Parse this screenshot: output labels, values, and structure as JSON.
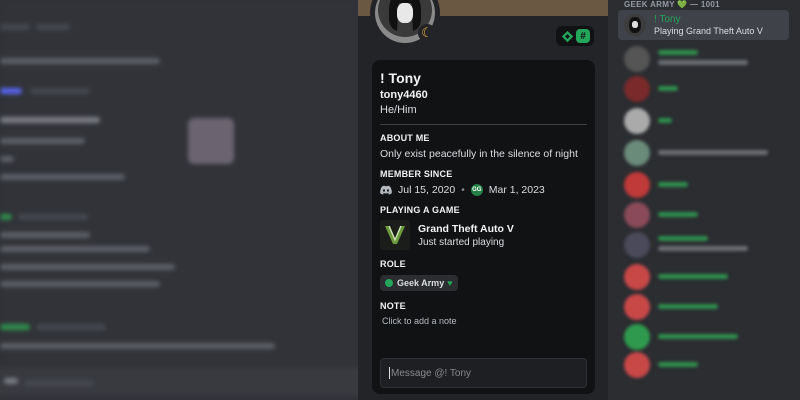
{
  "profile": {
    "display_name": "! Tony",
    "username": "tony4460",
    "pronouns": "He/Him",
    "about_me": {
      "title": "ABOUT ME",
      "text": "Only exist peacefully in the silence of night"
    },
    "member_since": {
      "title": "MEMBER SINCE",
      "discord_date": "Jul 15, 2020",
      "server_date": "Mar 1, 2023",
      "server_icon_text": "GG"
    },
    "activity": {
      "title": "PLAYING A GAME",
      "game": "Grand Theft Auto V",
      "status": "Just started playing"
    },
    "role": {
      "title": "ROLE",
      "name": "Geek Army",
      "color": "#23a55a"
    },
    "note": {
      "title": "NOTE",
      "placeholder": "Click to add a note"
    },
    "message": {
      "placeholder": "Message @! Tony"
    },
    "badges": [
      "hypesquad-icon",
      "hash-badge-icon"
    ],
    "status_icon": "idle-moon-icon"
  },
  "member_list": {
    "group_header": "GEEK ARMY 💚 — 1001",
    "selected_member": {
      "name": "! Tony",
      "activity": "Playing Grand Theft Auto V",
      "name_color": "#23a55a"
    }
  },
  "colors": {
    "accent_green": "#23a55a",
    "popout_bg": "#232428",
    "card_bg": "#111214"
  }
}
